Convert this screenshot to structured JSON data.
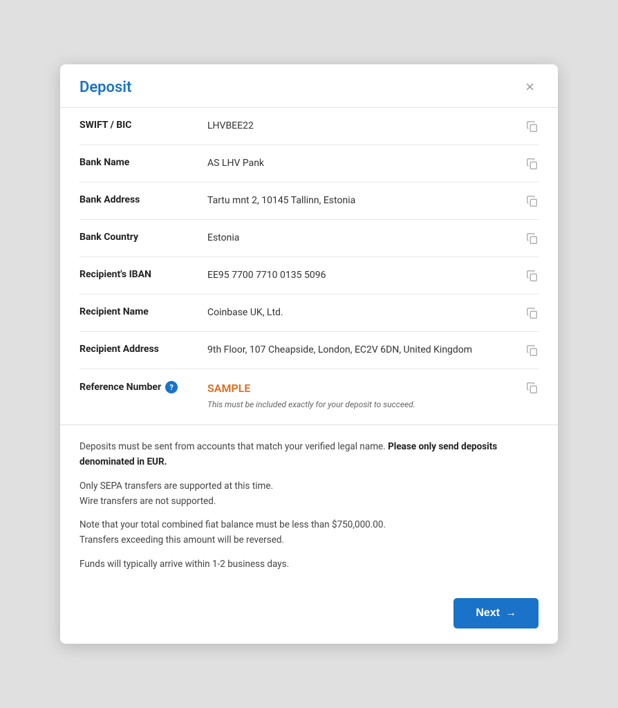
{
  "dialog": {
    "title": "Deposit",
    "close_label": "×"
  },
  "fields": [
    {
      "id": "swift-bic",
      "label": "SWIFT / BIC",
      "value": "LHVBEE22",
      "has_help": false,
      "has_copy": true
    },
    {
      "id": "bank-name",
      "label": "Bank Name",
      "value": "AS LHV Pank",
      "has_help": false,
      "has_copy": true
    },
    {
      "id": "bank-address",
      "label": "Bank Address",
      "value": "Tartu mnt 2, 10145 Tallinn, Estonia",
      "has_help": false,
      "has_copy": true
    },
    {
      "id": "bank-country",
      "label": "Bank Country",
      "value": "Estonia",
      "has_help": false,
      "has_copy": true
    },
    {
      "id": "recipient-iban",
      "label": "Recipient's IBAN",
      "value": "EE95 7700 7710 0135 5096",
      "has_help": false,
      "has_copy": true
    },
    {
      "id": "recipient-name",
      "label": "Recipient Name",
      "value": "Coinbase UK, Ltd.",
      "has_help": false,
      "has_copy": true
    },
    {
      "id": "recipient-address",
      "label": "Recipient Address",
      "value": "9th Floor, 107 Cheapside, London, EC2V 6DN, United Kingdom",
      "has_help": false,
      "has_copy": true
    },
    {
      "id": "reference-number",
      "label": "Reference Number",
      "value": "SAMPLE",
      "sub_text": "This must be included exactly for your deposit to succeed.",
      "has_help": true,
      "has_copy": true,
      "is_sample": true
    }
  ],
  "notices": [
    {
      "id": "notice-1",
      "text_plain": "Deposits must be sent from accounts that match your verified legal name. ",
      "text_bold": "Please only send deposits denominated in EUR."
    },
    {
      "id": "notice-2",
      "text_plain": "Only SEPA transfers are supported at this time.\nWire transfers are not supported."
    },
    {
      "id": "notice-3",
      "text_plain": "Note that your total combined fiat balance must be less than $750,000.00.\nTransfers exceeding this amount will be reversed."
    },
    {
      "id": "notice-4",
      "text_plain": "Funds will typically arrive within 1-2 business days."
    }
  ],
  "footer": {
    "next_label": "Next",
    "next_arrow": "→"
  }
}
